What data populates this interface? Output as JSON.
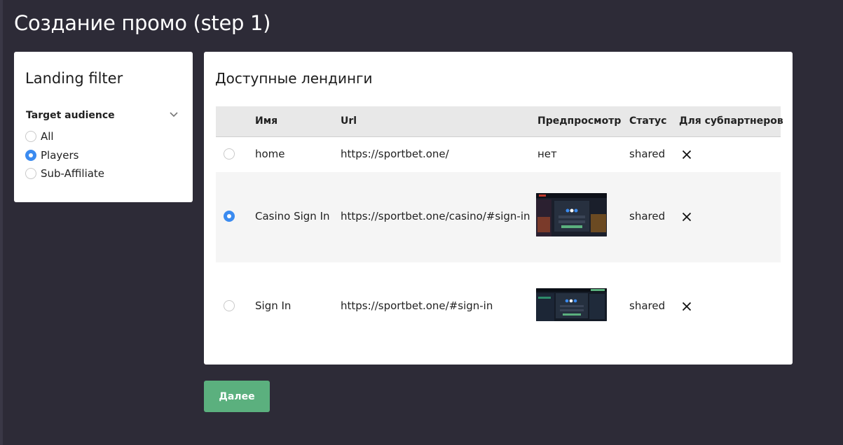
{
  "page": {
    "title": "Создание промо (step 1)"
  },
  "filter": {
    "title": "Landing filter",
    "section_label": "Target audience",
    "options": [
      {
        "label": "All",
        "selected": false
      },
      {
        "label": "Players",
        "selected": true
      },
      {
        "label": "Sub-Affiliate",
        "selected": false
      }
    ]
  },
  "landings": {
    "title": "Доступные лендинги",
    "columns": [
      "Имя",
      "Url",
      "Предпросмотр",
      "Статус",
      "Для субпартнеров"
    ],
    "rows": [
      {
        "name": "home",
        "url": "https://sportbet.one/",
        "preview": "нет",
        "status": "shared",
        "subpartners": "no",
        "selected": false
      },
      {
        "name": "Casino Sign In",
        "url": "https://sportbet.one/casino/#sign-in",
        "preview": "",
        "status": "shared",
        "subpartners": "no",
        "selected": true
      },
      {
        "name": "Sign In",
        "url": "https://sportbet.one/#sign-in",
        "preview": "",
        "status": "shared",
        "subpartners": "no",
        "selected": false
      }
    ]
  },
  "actions": {
    "next_label": "Далее"
  },
  "colors": {
    "background": "#2d2b37",
    "accent": "#3b8bf0",
    "button": "#5bb07e"
  }
}
